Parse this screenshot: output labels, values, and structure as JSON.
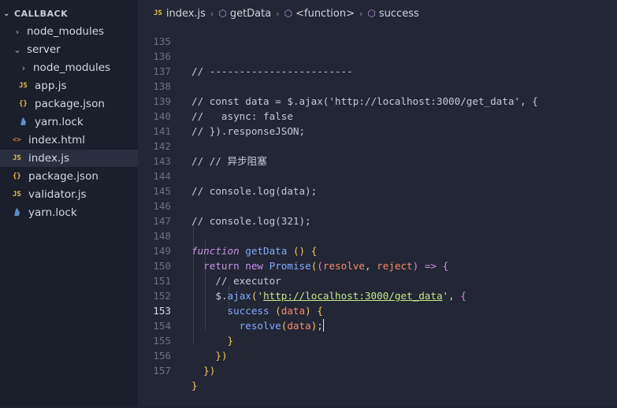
{
  "sidebar": {
    "section_title": "CALLBACK",
    "items": [
      {
        "label": "node_modules",
        "kind": "folder",
        "icon": "chevron-right-icon"
      },
      {
        "label": "server",
        "kind": "folder-open",
        "icon": "chevron-down-icon"
      },
      {
        "label": "node_modules",
        "kind": "folder",
        "icon": "chevron-right-icon"
      },
      {
        "label": "app.js",
        "kind": "js",
        "icon": "js-file-icon",
        "icon_text": "JS"
      },
      {
        "label": "package.json",
        "kind": "json",
        "icon": "json-file-icon",
        "icon_text": "{}"
      },
      {
        "label": "yarn.lock",
        "kind": "yarn",
        "icon": "yarn-file-icon"
      },
      {
        "label": "index.html",
        "kind": "html",
        "icon": "html-file-icon",
        "icon_text": "<>"
      },
      {
        "label": "index.js",
        "kind": "js",
        "icon": "js-file-icon",
        "icon_text": "JS",
        "active": true
      },
      {
        "label": "package.json",
        "kind": "json",
        "icon": "json-file-icon",
        "icon_text": "{}"
      },
      {
        "label": "validator.js",
        "kind": "js",
        "icon": "js-file-icon",
        "icon_text": "JS"
      },
      {
        "label": "yarn.lock",
        "kind": "yarn",
        "icon": "yarn-file-icon"
      }
    ]
  },
  "breadcrumb": {
    "file_icon_text": "JS",
    "file": "index.js",
    "symbols": [
      "getData",
      "<function>",
      "success"
    ]
  },
  "editor": {
    "current_line": 153,
    "lines": [
      {
        "n": "135",
        "text": ""
      },
      {
        "n": "136",
        "text": "// ------------------------"
      },
      {
        "n": "137",
        "text": ""
      },
      {
        "n": "138",
        "text": "// const data = $.ajax('http://localhost:3000/get_data', {"
      },
      {
        "n": "139",
        "text": "//   async: false"
      },
      {
        "n": "140",
        "text": "// }).responseJSON;"
      },
      {
        "n": "141",
        "text": ""
      },
      {
        "n": "142",
        "text": "// // 异步阻塞"
      },
      {
        "n": "143",
        "text": ""
      },
      {
        "n": "144",
        "text": "// console.log(data);"
      },
      {
        "n": "145",
        "text": ""
      },
      {
        "n": "146",
        "text": "// console.log(321);"
      },
      {
        "n": "147",
        "text": ""
      },
      {
        "n": "148",
        "text": "function getData () {"
      },
      {
        "n": "149",
        "text": "  return new Promise((resolve, reject) => {"
      },
      {
        "n": "150",
        "text": "    // executor"
      },
      {
        "n": "151",
        "text": "    $.ajax('http://localhost:3000/get_data', {"
      },
      {
        "n": "152",
        "text": "      success (data) {"
      },
      {
        "n": "153",
        "text": "        resolve(data);"
      },
      {
        "n": "154",
        "text": "      }"
      },
      {
        "n": "155",
        "text": "    })"
      },
      {
        "n": "156",
        "text": "  })"
      },
      {
        "n": "157",
        "text": "}"
      }
    ]
  },
  "colors": {
    "sidebar_bg": "#1b1e2b",
    "editor_bg": "#232634",
    "comment": "#8f95a8",
    "keyword": "#c792ea",
    "function": "#82aaff",
    "string": "#c3e88d",
    "parameter": "#f78c6c"
  }
}
